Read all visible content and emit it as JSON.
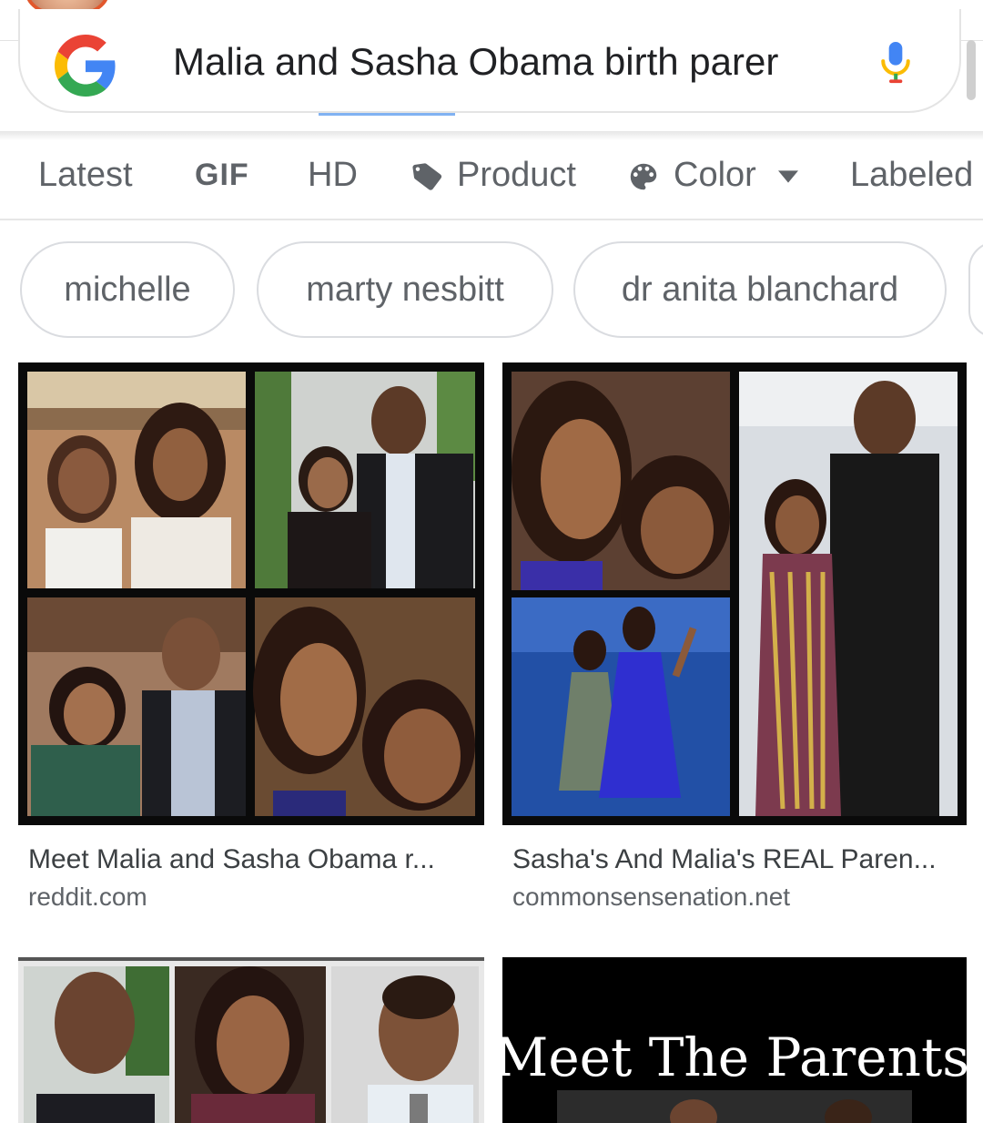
{
  "search": {
    "query": "Malia and Sasha Obama birth parer"
  },
  "filters": [
    {
      "label": "Latest"
    },
    {
      "label": "GIF"
    },
    {
      "label": "HD"
    },
    {
      "label": "Product"
    },
    {
      "label": "Color"
    },
    {
      "label": "Labeled"
    }
  ],
  "chips": [
    {
      "label": "michelle"
    },
    {
      "label": "marty nesbitt"
    },
    {
      "label": "dr anita blanchard"
    }
  ],
  "results": [
    {
      "title": "Meet Malia and Sasha Obama r...",
      "source": "reddit.com"
    },
    {
      "title": "Sasha's And Malia's REAL Paren...",
      "source": "commonsensenation.net"
    }
  ],
  "bottom_result": {
    "thumb_text": "Meet The Parents"
  },
  "icons": {
    "logo": "google-g-icon",
    "mic": "mic-icon",
    "product": "tag-icon",
    "color": "palette-icon",
    "dropdown": "caret-down-icon"
  },
  "colors": {
    "google_blue": "#4285F4",
    "google_red": "#EA4335",
    "google_yellow": "#FBBC05",
    "google_green": "#34A853"
  }
}
